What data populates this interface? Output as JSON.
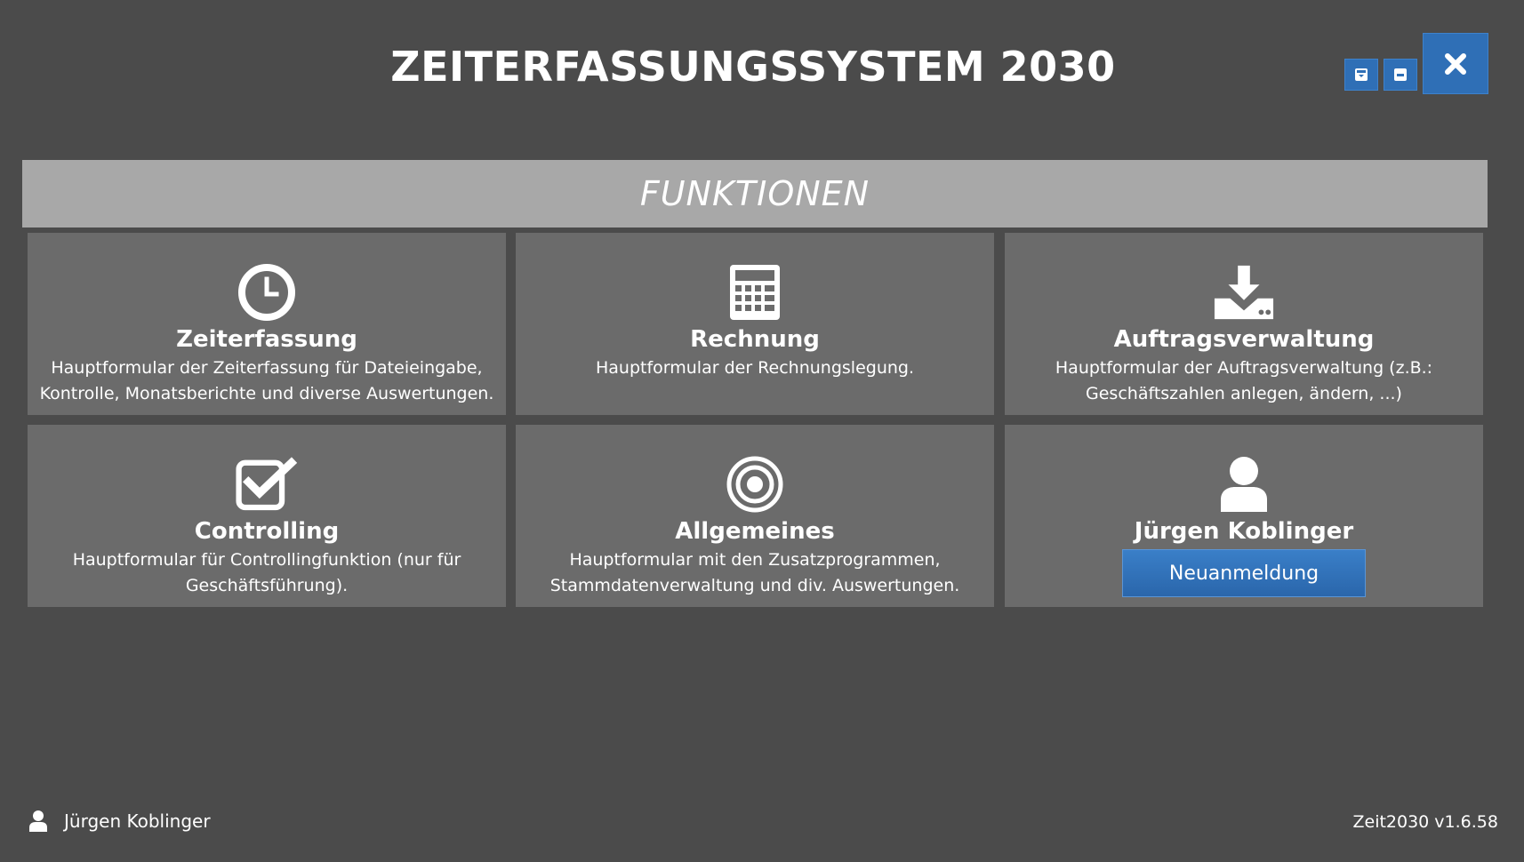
{
  "window": {
    "title": "ZEITERFASSUNGSSYSTEM 2030",
    "accent_color": "#2f6fb6",
    "background_color": "#4b4b4b",
    "buttons": [
      {
        "name": "restore",
        "icon": "restore-icon"
      },
      {
        "name": "minimize",
        "icon": "minimize-icon"
      },
      {
        "name": "close",
        "icon": "close-icon"
      }
    ]
  },
  "section": {
    "title": "FUNKTIONEN",
    "bar_color": "#a8a8a8"
  },
  "tiles": [
    {
      "title": "Zeiterfassung",
      "icon": "clock-icon",
      "description": "Hauptformular der Zeiterfassung für Dateieingabe,\nKontrolle, Monatsberichte und diverse Auswertungen."
    },
    {
      "title": "Rechnung",
      "icon": "calculator-icon",
      "description": "Hauptformular der Rechnungslegung."
    },
    {
      "title": "Auftragsverwaltung",
      "icon": "download-icon",
      "description": "Hauptformular der Auftragsverwaltung (z.B.:\nGeschäftszahlen anlegen, ändern, ...)"
    },
    {
      "title": "Controlling",
      "icon": "checkbox-icon",
      "description": "Hauptformular für Controllingfunktion (nur für\nGeschäftsführung)."
    },
    {
      "title": "Allgemeines",
      "icon": "target-icon",
      "description": "Hauptformular mit den Zusatzprogrammen,\nStammdatenverwaltung und div. Auswertungen."
    },
    {
      "title": "Jürgen Koblinger",
      "icon": "user-icon",
      "button_label": "Neuanmeldung"
    }
  ],
  "footer": {
    "user_name": "Jürgen Koblinger",
    "user_icon": "user-icon",
    "version": "Zeit2030 v1.6.58"
  }
}
